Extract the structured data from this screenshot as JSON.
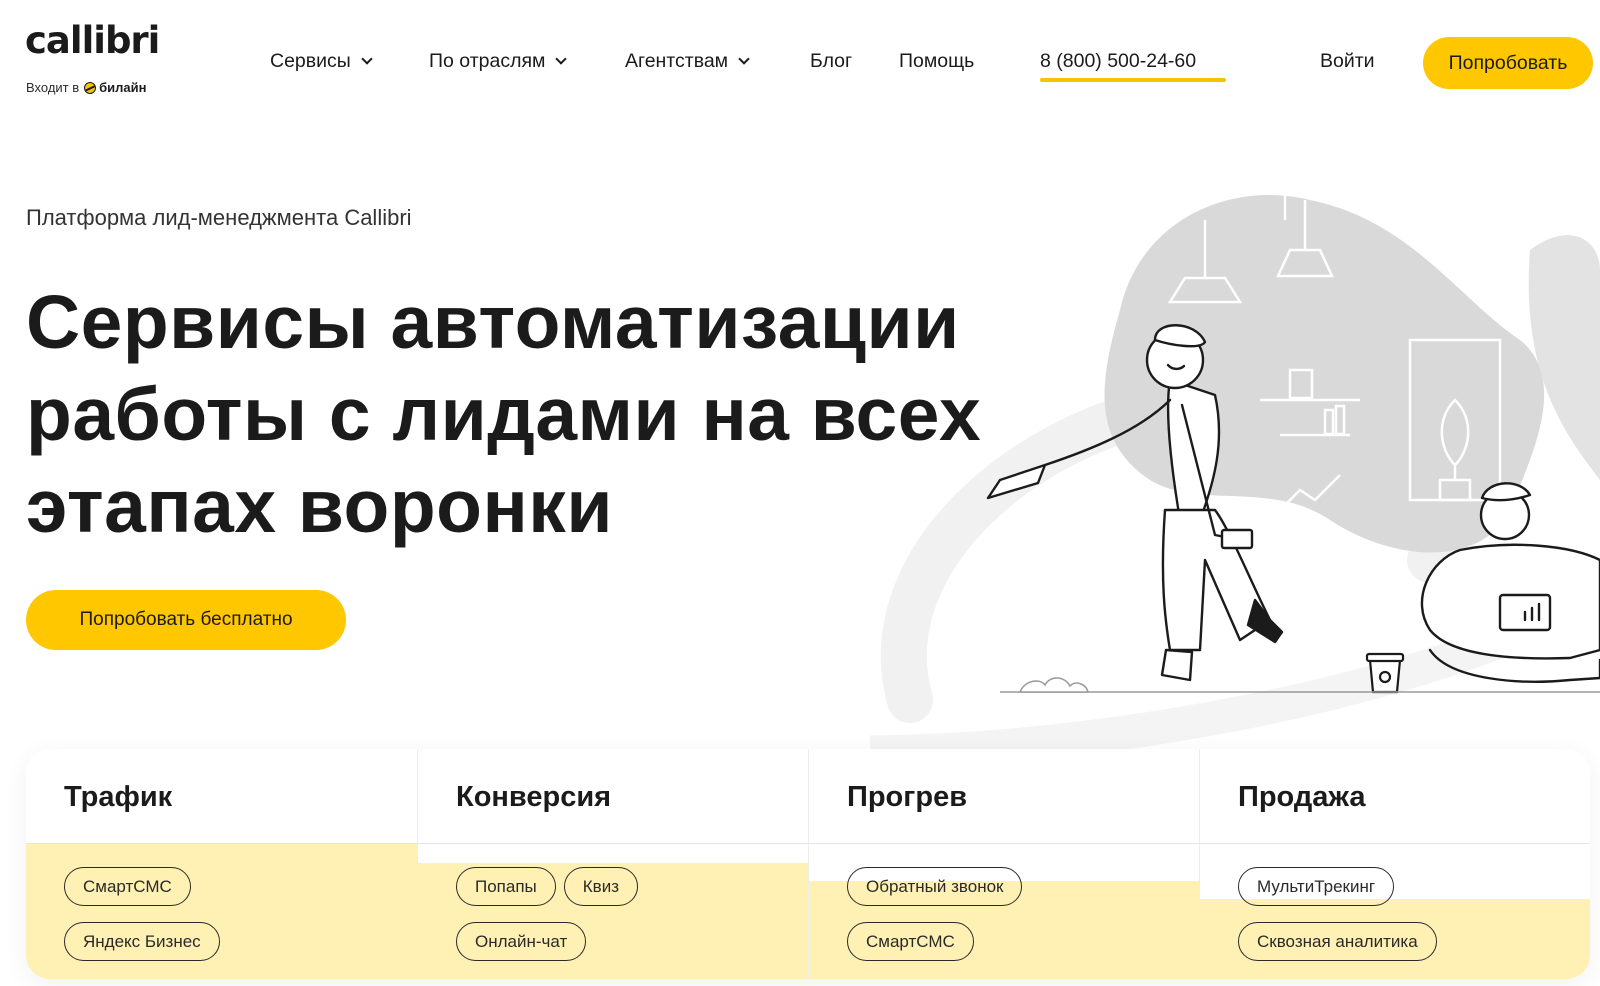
{
  "header": {
    "logo_text": "callibri",
    "logo_sub_prefix": "Входит в",
    "logo_sub_brand": "билайн",
    "nav": [
      {
        "label": "Сервисы",
        "dropdown": true
      },
      {
        "label": "По отраслям",
        "dropdown": true
      },
      {
        "label": "Агентствам",
        "dropdown": true
      },
      {
        "label": "Блог",
        "dropdown": false
      },
      {
        "label": "Помощь",
        "dropdown": false
      }
    ],
    "phone": "8 (800) 500-24-60",
    "login": "Войти",
    "try_button": "Попробовать"
  },
  "hero": {
    "eyebrow": "Платформа лид-менеджмента Callibri",
    "title_lines": [
      "Сервисы автоматизации",
      "работы с лидами на всех",
      "этапах воронки"
    ],
    "cta": "Попробовать бесплатно"
  },
  "cards": [
    {
      "title": "Трафик",
      "tags": [
        "СмартСМС",
        "Яндекс Бизнес"
      ]
    },
    {
      "title": "Конверсия",
      "tags": [
        "Попапы",
        "Квиз",
        "Онлайн-чат"
      ]
    },
    {
      "title": "Прогрев",
      "tags": [
        "Обратный звонок",
        "СмартСМС"
      ]
    },
    {
      "title": "Продажа",
      "tags": [
        "МультиТрекинг",
        "Сквозная аналитика"
      ]
    }
  ],
  "colors": {
    "accent_yellow": "#ffc700",
    "card_fill": "#fff0b3",
    "text_dark": "#1b1b1b",
    "illustration_gray": "#d9d9d9"
  }
}
